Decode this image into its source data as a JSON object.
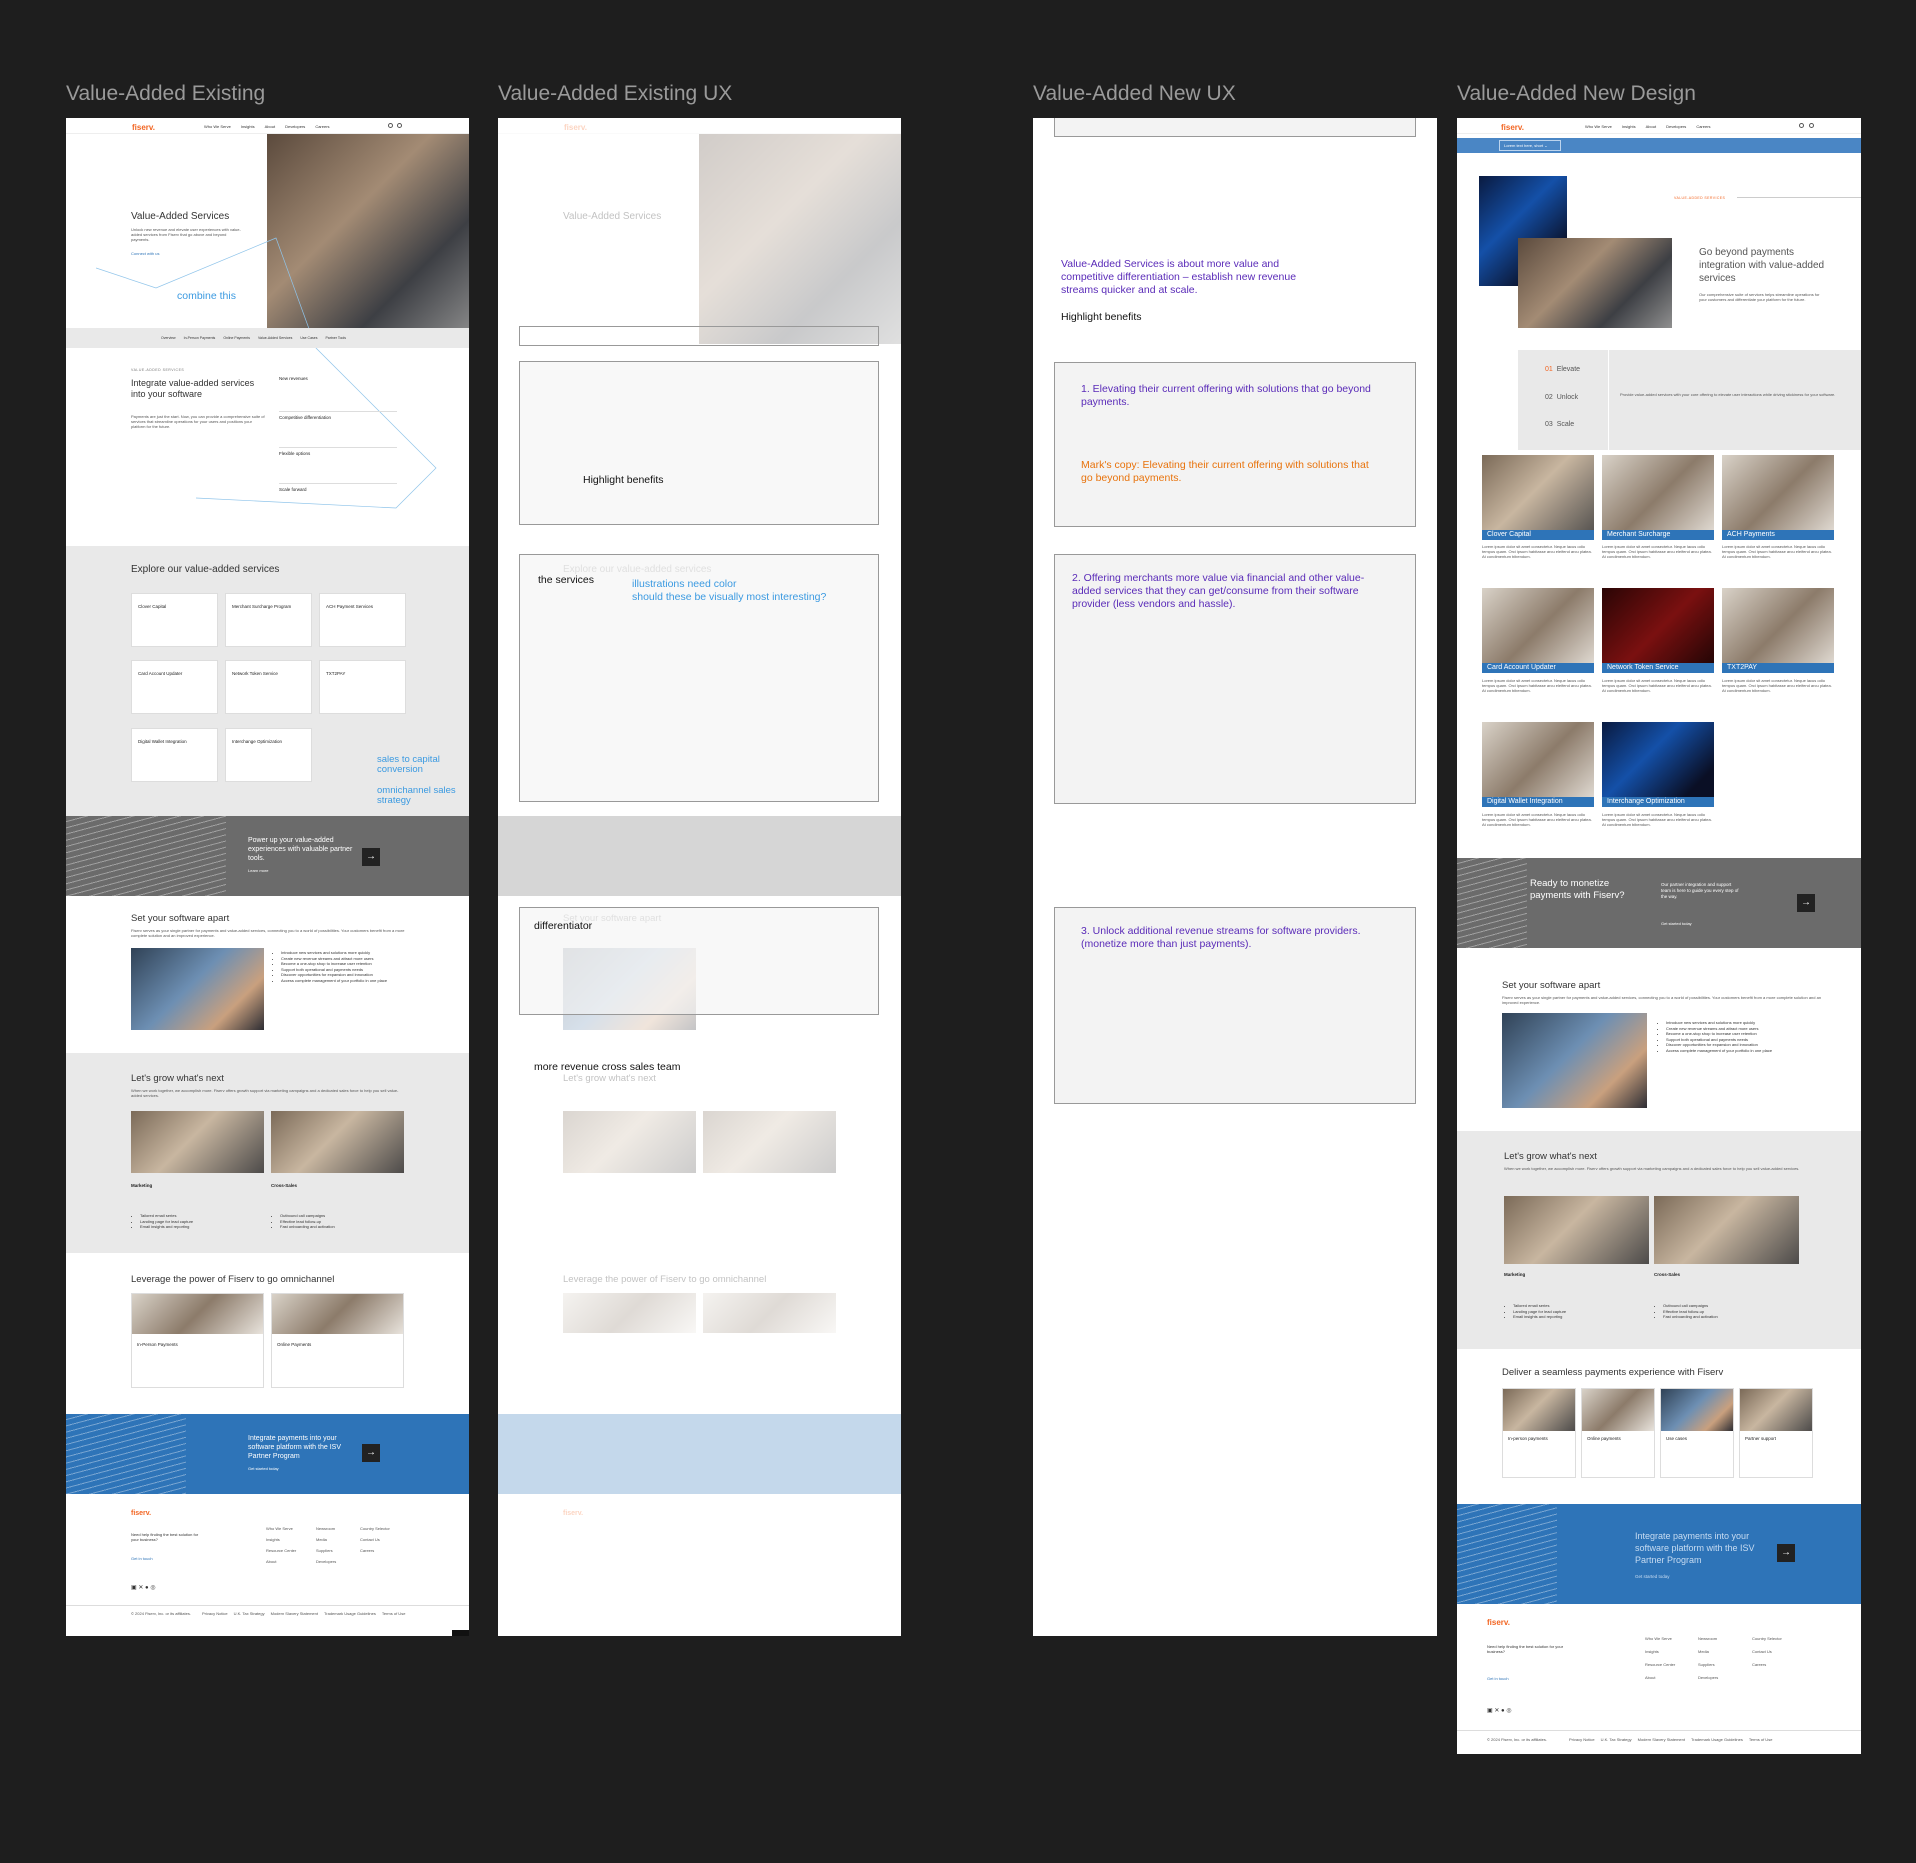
{
  "frames": {
    "existing": {
      "title": "Value-Added Existing",
      "logo": "fiserv.",
      "nav": [
        "Who We Serve",
        "Insights",
        "About",
        "Developers",
        "Careers"
      ],
      "hero_title": "Value-Added Services",
      "hero_body": "Unlock new revenue and elevate user experiences with value-added services from Fiserv that go above and beyond payments.",
      "hero_link": "Connect with us",
      "annotation_combine": "combine this",
      "subnav": [
        "Overview",
        "In-Person Payments",
        "Online Payments",
        "Value-Added Services",
        "Use Cases",
        "Partner Tools"
      ],
      "eyebrow": "VALUE-ADDED SERVICES",
      "integrate_title": "Integrate value-added services into your software",
      "integrate_body": "Payments are just the start. Now, you can provide a comprehensive suite of services that streamline operations for your users and positions your platform for the future.",
      "accordion": [
        "New revenues",
        "Competitive differentiation",
        "Flexible options",
        "Scale forward"
      ],
      "explore_title": "Explore our value-added services",
      "services": [
        "Clover Capital",
        "Merchant Surcharge Program",
        "ACH Payment Services",
        "Card Account Updater",
        "Network Token Service",
        "TXT2PAY",
        "Digital Wallet Integration",
        "Interchange Optimization"
      ],
      "annotation_sales": "sales to capital conversion",
      "annotation_omni": "omnichannel sales strategy",
      "band_title": "Power up your value-added experiences with valuable partner tools.",
      "band_link": "Learn more",
      "apart_title": "Set your software apart",
      "apart_body": "Fiserv serves as your single partner for payments and value-added services, connecting you to a world of possibilities. Your customers benefit from a more complete solution and an improved experience.",
      "apart_list": [
        "Introduce new services and solutions more quickly",
        "Create new revenue streams and attract more users",
        "Become a one-stop shop to increase user retention",
        "Support both operational and payments needs",
        "Discover opportunities for expansion and innovation",
        "Access complete management of your portfolio in one place"
      ],
      "grow_title": "Let's grow what's next",
      "grow_body": "When we work together, we accomplish more. Fiserv offers growth support via marketing campaigns and a dedicated sales force to help you sell value-added services.",
      "marketing_title": "Marketing",
      "marketing_list": [
        "Tailored email series",
        "Landing page for lead capture",
        "Email insights and reporting"
      ],
      "crosssales_title": "Cross-Sales",
      "crosssales_list": [
        "Outbound call campaigns",
        "Effective lead follow-up",
        "Fast onboarding and activation"
      ],
      "omni_title": "Leverage the power of Fiserv to go omnichannel",
      "inperson": "In-Person Payments",
      "online": "Online Payments",
      "blue_band": "Integrate payments into your software platform with the ISV Partner Program",
      "blue_link": "Get started today",
      "footer_help": "Need help finding the best solution for your business?",
      "footer_link": "Get in touch",
      "footer_cols": [
        [
          "Who We Serve",
          "Insights",
          "Resource Center",
          "About"
        ],
        [
          "Newsroom",
          "Media",
          "Suppliers",
          "Developers"
        ],
        [
          "Country Selector",
          "Contact Us",
          "Careers"
        ]
      ],
      "footer_legal": "© 2024 Fiserv, Inc. or its affiliates.",
      "footer_links": [
        "Privacy Notice",
        "U.K. Tax Strategy",
        "Modern Slavery Statement",
        "Trademark Usage Guidelines",
        "Terms of Use"
      ]
    },
    "existing_ux": {
      "title": "Value-Added Existing UX",
      "label_highlight": "Highlight benefits",
      "label_services": "the services",
      "note_illustrations": "illustrations need color\nshould these be visually most interesting?",
      "label_differentiator": "differentiator",
      "label_crosssales": "more revenue cross sales team"
    },
    "new_ux": {
      "title": "Value-Added New UX",
      "intro": "Value-Added Services is about more value and competitive differentiation – establish new revenue streams quicker and at scale.",
      "highlight": "Highlight benefits",
      "box1_a": "1. Elevating their current offering with solutions that go beyond payments.",
      "box1_b": "Mark's copy: Elevating their current offering with solutions that go beyond payments.",
      "box2": "2. Offering merchants more value via financial and other value-added services that they can get/consume from their software provider (less vendors and hassle).",
      "box3": "3. Unlock additional revenue streams for software providers. (monetize more than just payments)."
    },
    "new_design": {
      "title": "Value-Added New Design",
      "logo": "fiserv.",
      "nav": [
        "Who We Serve",
        "Insights",
        "About",
        "Developers",
        "Careers"
      ],
      "dropdown": "Lorem text here, short",
      "eyebrow": "VALUE-ADDED SERVICES",
      "hero_title": "Go beyond payments integration with value-added services",
      "hero_body": "Our comprehensive suite of services helps streamline operations for your customers and differentiate your platform for the future.",
      "tabs": [
        {
          "num": "01",
          "label": "Elevate"
        },
        {
          "num": "02",
          "label": "Unlock"
        },
        {
          "num": "03",
          "label": "Scale"
        }
      ],
      "tab_body": "Provide value-added services with your core offering to elevate user interactions while driving stickiness for your software.",
      "services": [
        "Clover Capital",
        "Merchant Surcharge",
        "ACH Payments",
        "Card Account Updater",
        "Network Token Service",
        "TXT2PAY",
        "Digital Wallet Integration",
        "Interchange Optimization"
      ],
      "lorem": "Lorem ipsum dolor sit amet consectetur. Neque lacus odio tempus quam. Orci ipsum habitasse arcu eleifend arcu platea. At condimentum bibendum.",
      "band_title": "Ready to monetize payments with Fiserv?",
      "band_body": "Our partner integration and support team is here to guide you every step of the way.",
      "band_link": "Get started today",
      "apart_title": "Set your software apart",
      "grow_title": "Let's grow what's next",
      "deliver_title": "Deliver a seamless payments experience with Fiserv",
      "deliver_cards": [
        "In-person payments",
        "Online payments",
        "Use cases",
        "Partner support"
      ],
      "blue_band": "Integrate payments into your software platform with the ISV Partner Program",
      "blue_link": "Get started today"
    }
  }
}
